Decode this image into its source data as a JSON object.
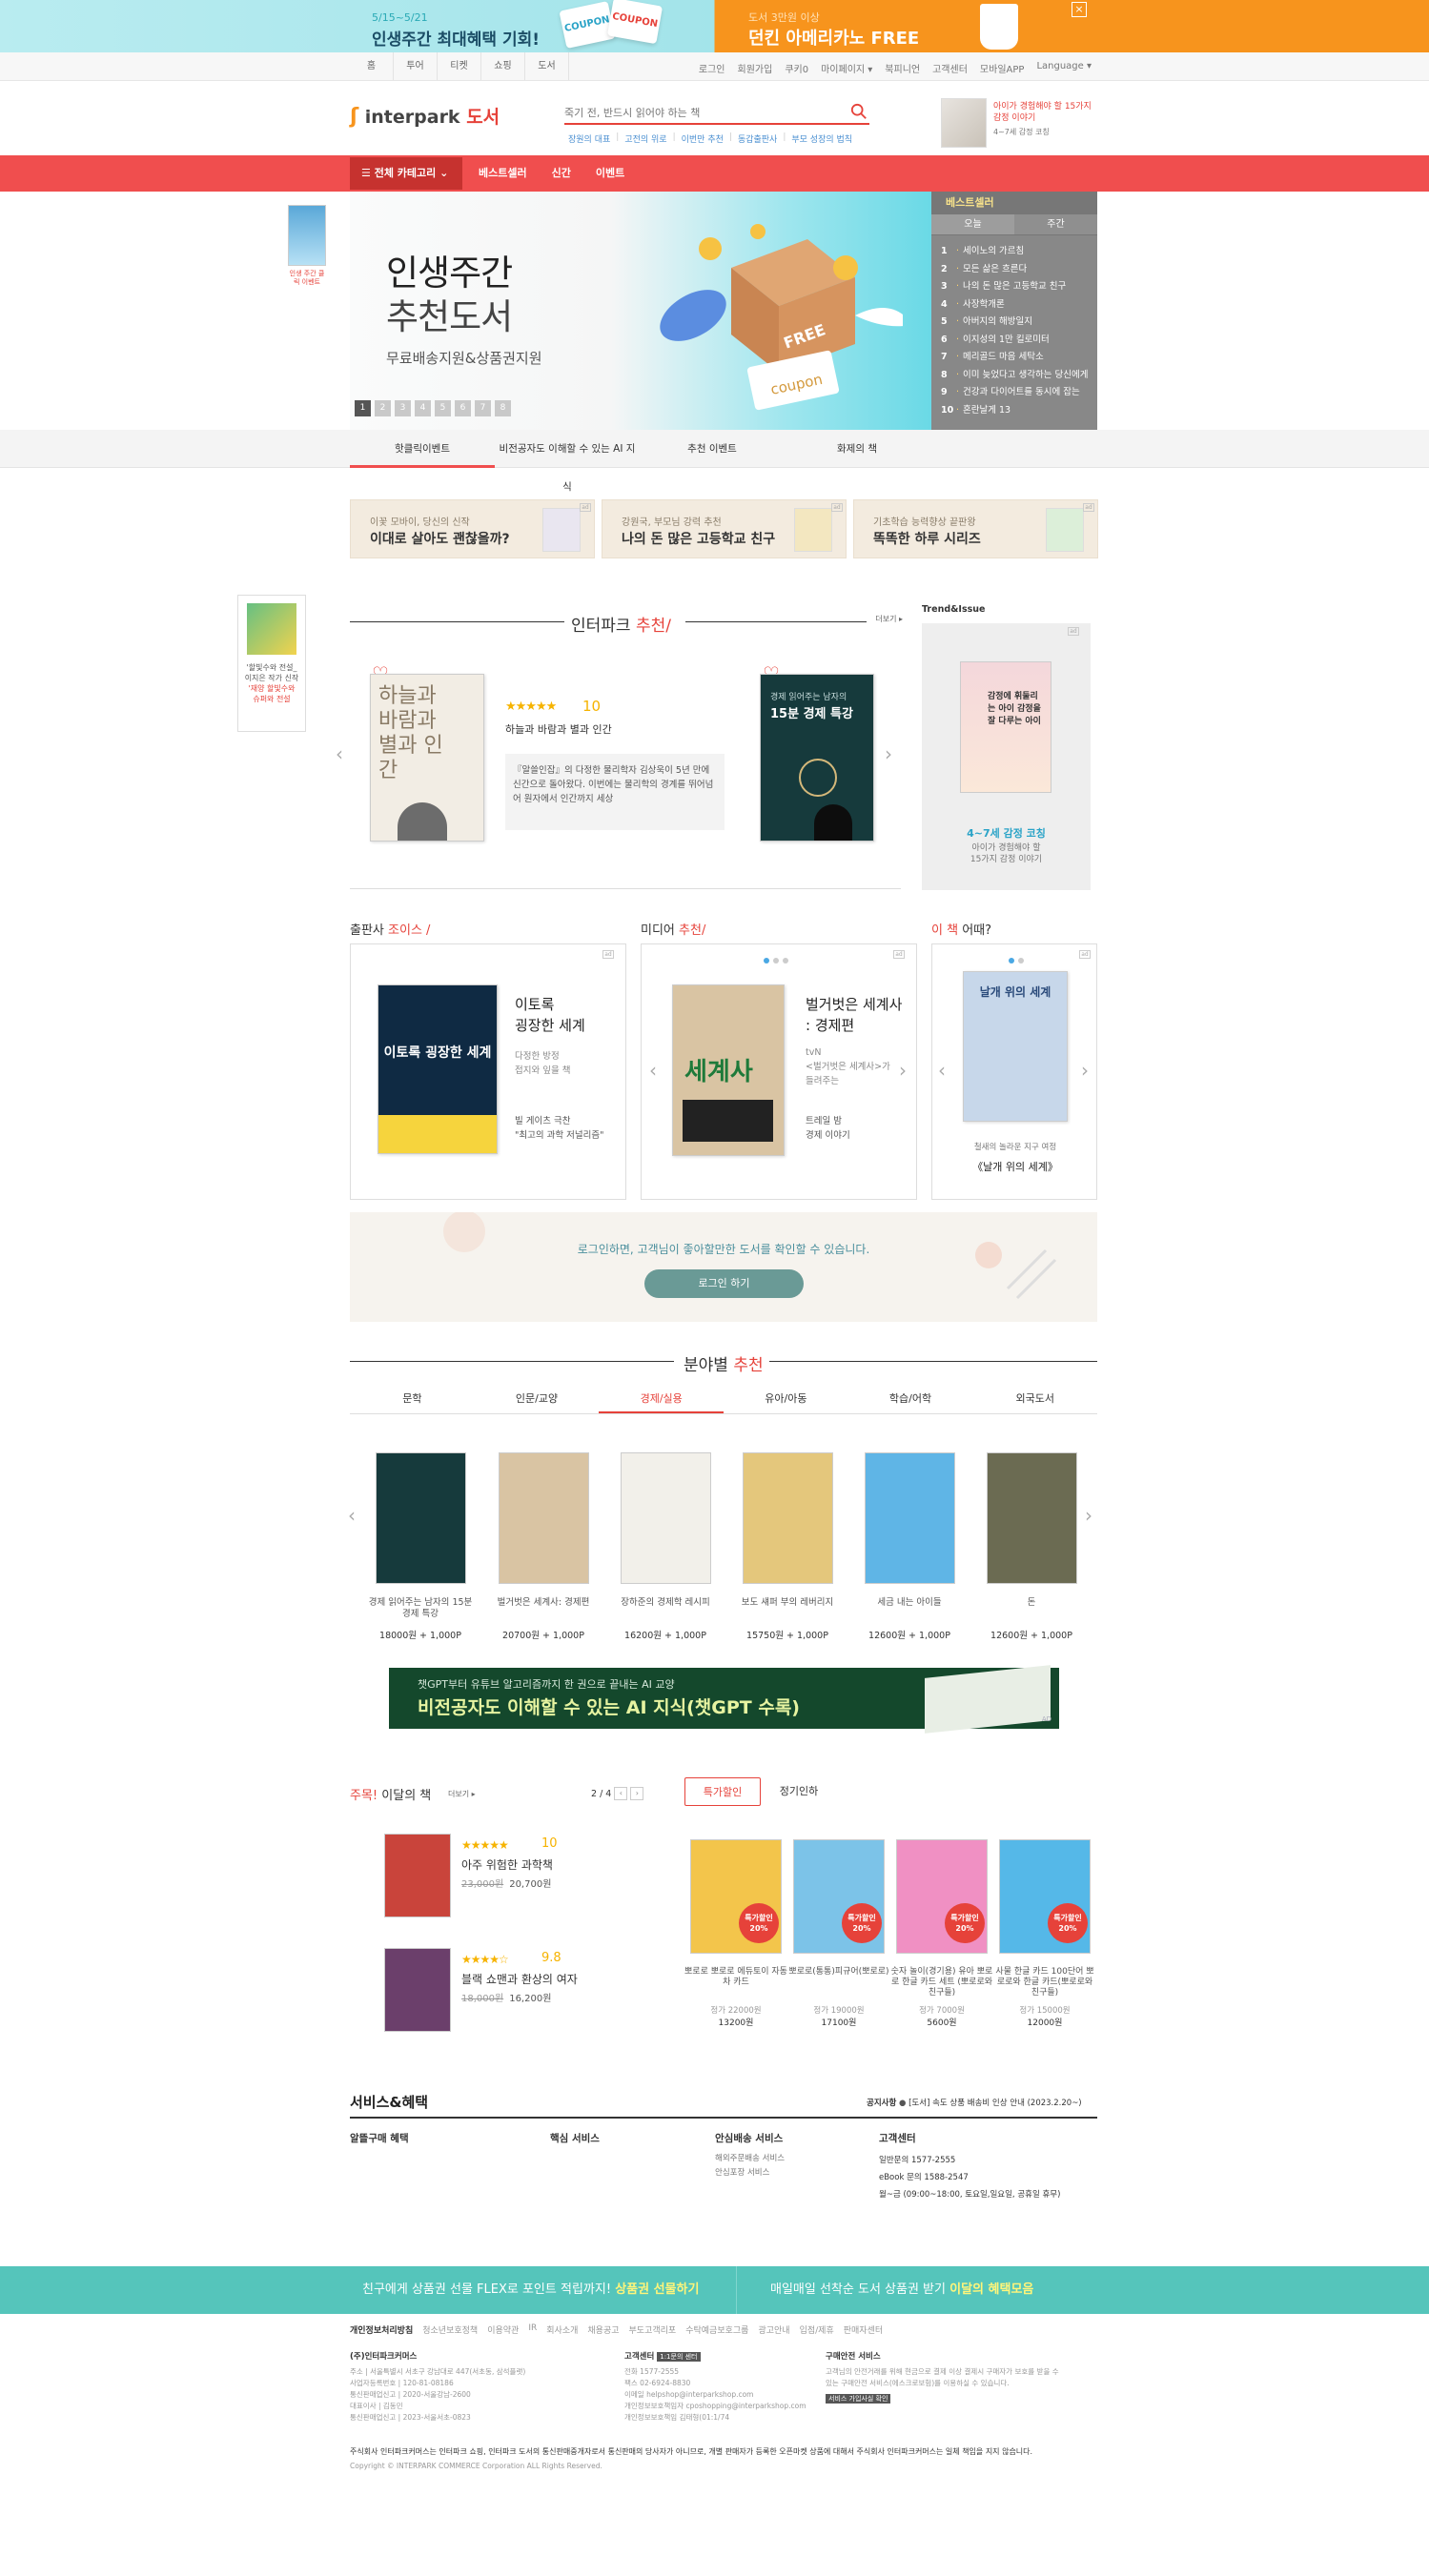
{
  "top_banner": {
    "left_date": "5/15~5/21",
    "left_title": "인생주간 최대혜택 기회!",
    "coupon1": "COUPON",
    "coupon2": "COUPON",
    "right_sub": "도서 3만원 이상",
    "right_title": "던킨 아메리카노 FREE",
    "close": "×",
    "colors": {
      "left_bg": "#a3e4ea",
      "right_bg": "#f7941d"
    }
  },
  "util": {
    "tabs": [
      "홈",
      "투어",
      "티켓",
      "쇼핑",
      "도서"
    ],
    "links": [
      "로그인",
      "회원가입",
      "쿠키0",
      "마이페이지 ▾",
      "북피니언",
      "고객센터",
      "모바일APP",
      "Language ▾"
    ]
  },
  "header": {
    "logo_main": "interpark",
    "logo_sub": "도서",
    "search_placeholder": "죽기 전, 반드시 읽어야 하는 책",
    "keywords": [
      "장원의 대표",
      "고전의 위로",
      "이번만 추천",
      "동갑출판사",
      "부모 성장의 법칙"
    ],
    "ad_title": "아이가 경험해야 할 15가지 감정 이야기",
    "ad_sub": "4~7세 감정 코칭"
  },
  "gnb": {
    "category": "전체 카테고리",
    "menu": [
      "베스트셀러",
      "신간",
      "이벤트"
    ],
    "accent": "#f04e4e"
  },
  "hero": {
    "title_line1": "인생주간",
    "title_line2": "추천도서",
    "subtitle": "무료배송지원&상품권지원",
    "pages": [
      "1",
      "2",
      "3",
      "4",
      "5",
      "6",
      "7",
      "8"
    ],
    "free_tag": "FREE",
    "coupon_tag": "coupon"
  },
  "hero_left": {
    "text": "인생 주간 클릭 이벤트"
  },
  "bestseller": {
    "title": "베스트셀러",
    "tabs": [
      "오늘",
      "주간"
    ],
    "items": [
      {
        "rank": "1",
        "title": "세이노의 가르침"
      },
      {
        "rank": "2",
        "title": "모든 삶은 흐른다"
      },
      {
        "rank": "3",
        "title": "나의 돈 많은 고등학교 친구"
      },
      {
        "rank": "4",
        "title": "사장학개론"
      },
      {
        "rank": "5",
        "title": "아버지의 해방일지"
      },
      {
        "rank": "6",
        "title": "이지성의 1만 킬로미터"
      },
      {
        "rank": "7",
        "title": "메리골드 마음 세탁소"
      },
      {
        "rank": "8",
        "title": "이미 늦었다고 생각하는 당신에게"
      },
      {
        "rank": "9",
        "title": "건강과 다이어트를 동시에 잡는"
      },
      {
        "rank": "10",
        "title": "혼란날게 13"
      }
    ]
  },
  "sub_tabs": [
    "핫클릭이벤트",
    "비전공자도 이해할 수 있는 AI 지식",
    "추천 이벤트",
    "화제의 책"
  ],
  "promos": [
    {
      "t1": "이꽃 모바이, 당신의 신작",
      "t2": "이대로 살아도 괜찮을까?"
    },
    {
      "t1": "강원국, 부모님 강력 추천",
      "t2": "나의 돈 많은 고등학교 친구"
    },
    {
      "t1": "기초학습 능력향상 끝판왕",
      "t2": "똑똑한 하루 시리즈"
    }
  ],
  "float_left": {
    "t1": "'할빛수와 전설_",
    "t2": "이지은 작가 신작",
    "t3": "'재양 할빛수와",
    "t4": "슈퍼와 전설"
  },
  "recommend": {
    "title_a": "인터파크",
    "title_b": "추천/",
    "more": "더보기 ▸",
    "book1_cover": "하늘과 바람과 별과 인간",
    "stars": "★★★★★",
    "score": "10",
    "book_name": "하늘과 바람과 별과 인간",
    "desc": "『알쓸인잡』의 다정한 물리학자 김상욱이 5년 만에 신간으로 돌아왔다. 이번에는 물리학의 경계를 뛰어넘어 원자에서 인간까지 세상",
    "book2_cover_a": "경제 읽어주는 남자의",
    "book2_cover_b": "15분 경제 특강"
  },
  "trend": {
    "header": "Trend&Issue",
    "cover_text": "감정에 휘둘리는 아이 감정을 잘 다루는 아이",
    "t1": "4~7세 감정 코칭",
    "t2a": "아이가 경험해야 할",
    "t2b": "15가지 감정 이야기"
  },
  "publisher_choice": {
    "title_a": "출판사",
    "title_b": "조이스 /",
    "book_title_a": "이토록",
    "book_title_b": "굉장한 세계",
    "sub_a": "다정한 방정",
    "sub_b": "접지와 잎을 책",
    "author": "빌 게이츠 극찬",
    "quote": "\"최고의 과학 저널리즘\"",
    "cover": "이토록 굉장한 세계"
  },
  "media_rec": {
    "title_a": "미디어",
    "title_b": "추천/",
    "book_title_a": "벌거벗은 세계사",
    "book_title_b": ": 경제편",
    "sub_a": "tvN",
    "sub_b": "<벌거벗은 세계사>가",
    "sub_c": "들려주는",
    "t1": "트레일 밤",
    "t2": "경제 이야기",
    "cover": "세계사"
  },
  "this_book": {
    "title_a": "이 책",
    "title_b": "어때?",
    "cover": "날개 위의 세계",
    "sub": "철새의 놀라운 지구 여정",
    "name": "《날개 위의 세계》"
  },
  "login_banner": {
    "text": "로그인하면, 고객님이 좋아할만한 도서를 확인할 수 있습니다.",
    "button": "로그인 하기"
  },
  "field": {
    "title_a": "분야별",
    "title_b": "추천",
    "tabs": [
      "문학",
      "인문/교양",
      "경제/실용",
      "유아/아동",
      "학습/어학",
      "외국도서"
    ],
    "books": [
      {
        "name": "경제 읽어주는 남자의 15분 경제 특강",
        "price": "18000원 + 1,000P",
        "color": "#163a3c"
      },
      {
        "name": "벌거벗은 세계사: 경제편",
        "price": "20700원 + 1,000P",
        "color": "#d9c4a3"
      },
      {
        "name": "장하준의 경제학 레시피",
        "price": "16200원 + 1,000P",
        "color": "#f2f0ea"
      },
      {
        "name": "보도 섀퍼 부의 레버리지",
        "price": "15750원 + 1,000P",
        "color": "#e4c77c"
      },
      {
        "name": "세금 내는 아이들",
        "price": "12600원 + 1,000P",
        "color": "#5fb5e6"
      },
      {
        "name": "돈",
        "price": "12600원 + 1,000P",
        "color": "#6b6b52"
      }
    ]
  },
  "ai_banner": {
    "t1": "챗GPT부터 유튜브 알고리즘까지 한 권으로 끝내는 AI 교양",
    "t2": "비전공자도 이해할 수 있는 AI 지식(챗GPT 수록)",
    "ad": "AD"
  },
  "monthly": {
    "title_a": "주목!",
    "title_b": "이달의 책",
    "more": "더보기 ▸",
    "page": "2 / 4",
    "prev": "‹",
    "next": "›",
    "books": [
      {
        "stars": "★★★★★",
        "score": "10",
        "name": "아주 위험한 과학책",
        "orig": "23,000원",
        "price": "20,700원",
        "color": "#c9443b"
      },
      {
        "stars": "★★★★☆",
        "score": "9.8",
        "name": "블랙 쇼맨과 환상의 여자",
        "orig": "18,000원",
        "price": "16,200원",
        "color": "#6b3f6b"
      }
    ]
  },
  "deals": {
    "tabs": [
      "특가할인",
      "정기인하"
    ],
    "items": [
      {
        "name": "뽀로로 뽀로로 에듀토이 자동차 카드",
        "orig": "정가 22000원",
        "price": "13200원",
        "sale": "특가할인 20%",
        "color": "#f3c54b"
      },
      {
        "name": "뽀로로(통통)피규어(뽀로로)",
        "orig": "정가 19000원",
        "price": "17100원",
        "sale": "특가할인 20%",
        "color": "#7cc3e8"
      },
      {
        "name": "숫자 놀이(경기용) 유아 뽀로로 한글 카드 세트 (뽀로로와 친구들)",
        "orig": "정가 7000원",
        "price": "5600원",
        "sale": "특가할인 20%",
        "color": "#f090c3"
      },
      {
        "name": "사물 한글 카드 100단어 뽀로로와 한글 카드(뽀로로와 친구들)",
        "orig": "정가 15000원",
        "price": "12000원",
        "sale": "특가할인 20%",
        "color": "#55b8e8"
      }
    ]
  },
  "services": {
    "title": "서비스&혜택",
    "notice_label": "공지사항",
    "notice": "[도서] 속도 상품 배송비 인상 안내 (2023.2.20~)",
    "cols": [
      {
        "title": "알뜰구매 혜택",
        "items": []
      },
      {
        "title": "핵심 서비스",
        "items": []
      },
      {
        "title": "안심배송 서비스",
        "items": [
          "해외주문배송 서비스",
          "안심포장 서비스"
        ]
      },
      {
        "title": "고객센터",
        "items": [
          "일반문의 1577-2555",
          "eBook 문의 1588-2547",
          "월~금 (09:00~18:00, 토요일,일요일, 공휴일 휴무)"
        ]
      }
    ]
  },
  "teal": {
    "a1": "친구에게 상품권 선물 FLEX로 포인트 적립까지!",
    "a2": "상품권 선물하기",
    "b1": "매일매일 선착순 도서 상품권 받기",
    "b2": "이달의 혜택모음"
  },
  "footer": {
    "links": [
      "개인정보처리방침",
      "청소년보호정책",
      "이용약관",
      "IR",
      "회사소개",
      "채용공고",
      "부도고객리포",
      "수탁예금보호그룹",
      "광고안내",
      "입점/제휴",
      "판매자센터"
    ],
    "col1": {
      "title": "(주)인터파크커머스",
      "lines": [
        "주소 | 서울특별시 서초구 강남대로 447(서초동, 삼석플랫)",
        "사업자등록번호 | 120-81-08186",
        "통신판매업신고 | 2020-서울강남-2600",
        "대표이사 | 김동민",
        "통신판매업신고 | 2023-서울서초-0823"
      ]
    },
    "col2": {
      "title": "고객센터",
      "badge": "1:1문의 센터",
      "lines": [
        "전화 1577-2555",
        "팩스 02-6924-8830",
        "이메일 helpshop@interparkshop.com",
        "개인정보보호책임자 cposhopping@interparkshop.com",
        "개인정보보호책임 김태형(01:1/74"
      ]
    },
    "col3": {
      "title": "구매안전 서비스",
      "lines": [
        "고객님의 안전거래를 위해 현금으로 결제 이상 결제시 구매자가 보호를 받을 수",
        "있는 구매안전 서비스(에스크로보험)를 이용하실 수 있습니다."
      ],
      "badge": "서비스 가입사실 확인"
    },
    "note": "주식회사 인터파크커머스는 인터파크 쇼핑, 인터파크 도서의 통신판매중개자로서 통신판매의 당사자가 아니므로, 개별 판매자가 등록한 오픈마켓 상품에 대해서 주식회사 인터파크커머스는 일체 책임을 지지 않습니다.",
    "copyright": "Copyright © INTERPARK COMMERCE Corporation ALL Rights Reserved."
  }
}
